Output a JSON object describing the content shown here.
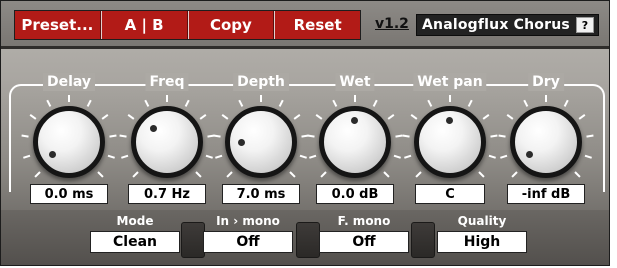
{
  "toolbar": {
    "preset_label": "Preset...",
    "ab_label": "A | B",
    "copy_label": "Copy",
    "reset_label": "Reset",
    "version": "v1.2",
    "title": "Analogflux Chorus",
    "help_label": "?"
  },
  "knobs": [
    {
      "label": "Delay",
      "value": "0.0 ms"
    },
    {
      "label": "Freq",
      "value": "0.7 Hz"
    },
    {
      "label": "Depth",
      "value": "7.0 ms"
    },
    {
      "label": "Wet",
      "value": "0.0 dB"
    },
    {
      "label": "Wet pan",
      "value": "C"
    },
    {
      "label": "Dry",
      "value": "-inf dB"
    }
  ],
  "options": [
    {
      "label": "Mode",
      "value": "Clean"
    },
    {
      "label": "In › mono",
      "value": "Off"
    },
    {
      "label": "F. mono",
      "value": "Off"
    },
    {
      "label": "Quality",
      "value": "High"
    }
  ],
  "colors": {
    "toolbar_button": "#b21b17",
    "panel_background": "#a9a6a1",
    "knob_ring": "#151515"
  }
}
